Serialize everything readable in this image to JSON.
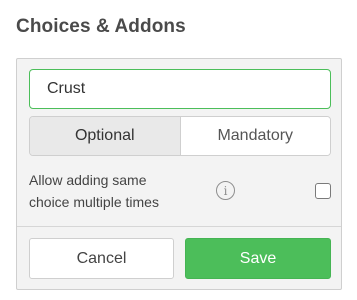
{
  "header": {
    "title": "Choices & Addons"
  },
  "form": {
    "name_value": "Crust",
    "type_options": [
      "Optional",
      "Mandatory"
    ],
    "selected_type": "Optional",
    "allow_label": "Allow adding same choice multiple times",
    "allow_checked": false,
    "info_glyph": "i",
    "info_icon": "info-icon"
  },
  "actions": {
    "cancel_label": "Cancel",
    "save_label": "Save"
  },
  "colors": {
    "accent": "#4cbe5a",
    "panel_bg": "#f3f3f3",
    "border": "#cfcfcf"
  }
}
